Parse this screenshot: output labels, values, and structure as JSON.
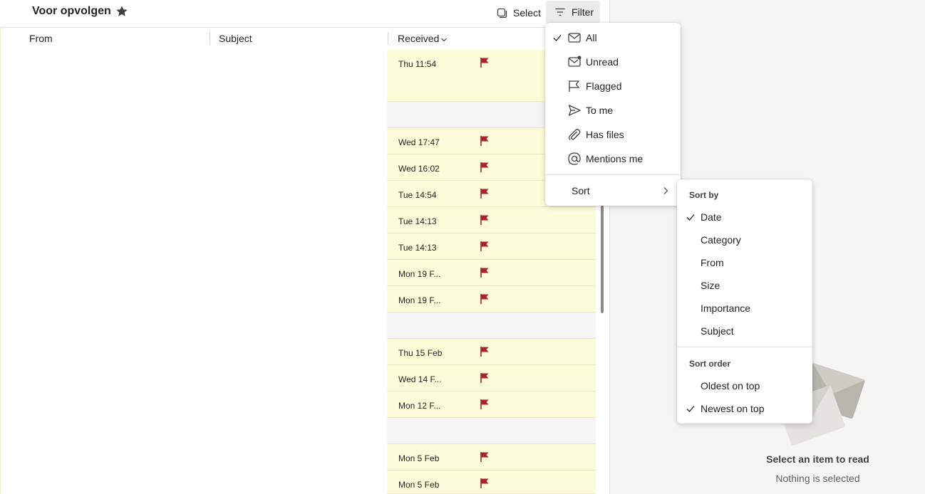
{
  "header": {
    "folder_title": "Voor opvolgen",
    "select_label": "Select",
    "filter_label": "Filter"
  },
  "columns": {
    "from": "From",
    "subject": "Subject",
    "received": "Received"
  },
  "rows": [
    {
      "date": "Thu 11:54",
      "flagged": true
    },
    {
      "date": "Wed 17:47",
      "flagged": true
    },
    {
      "date": "Wed 16:02",
      "flagged": true
    },
    {
      "date": "Tue 14:54",
      "flagged": true
    },
    {
      "date": "Tue 14:13",
      "flagged": true
    },
    {
      "date": "Tue 14:13",
      "flagged": true
    },
    {
      "date": "Mon 19 F...",
      "flagged": true
    },
    {
      "date": "Mon 19 F...",
      "flagged": true
    },
    {
      "date": "Thu 15 Feb",
      "flagged": true
    },
    {
      "date": "Wed 14 F...",
      "flagged": true
    },
    {
      "date": "Mon 12 F...",
      "flagged": true
    },
    {
      "date": "Mon 5 Feb",
      "flagged": true
    },
    {
      "date": "Mon 5 Feb",
      "flagged": true
    }
  ],
  "filter_menu": {
    "items": [
      {
        "label": "All",
        "icon": "mail-icon",
        "checked": true
      },
      {
        "label": "Unread",
        "icon": "mail-unread-icon",
        "checked": false
      },
      {
        "label": "Flagged",
        "icon": "flag-outline-icon",
        "checked": false
      },
      {
        "label": "To me",
        "icon": "send-icon",
        "checked": false
      },
      {
        "label": "Has files",
        "icon": "attach-icon",
        "checked": false
      },
      {
        "label": "Mentions me",
        "icon": "at-icon",
        "checked": false
      }
    ],
    "sort_label": "Sort"
  },
  "sort_menu": {
    "sort_by_heading": "Sort by",
    "sort_by": [
      {
        "label": "Date",
        "checked": true
      },
      {
        "label": "Category",
        "checked": false
      },
      {
        "label": "From",
        "checked": false
      },
      {
        "label": "Size",
        "checked": false
      },
      {
        "label": "Importance",
        "checked": false
      },
      {
        "label": "Subject",
        "checked": false
      }
    ],
    "sort_order_heading": "Sort order",
    "sort_order": [
      {
        "label": "Oldest on top",
        "checked": false
      },
      {
        "label": "Newest on top",
        "checked": true
      }
    ]
  },
  "reading_pane": {
    "title": "Select an item to read",
    "subtitle": "Nothing is selected"
  },
  "colors": {
    "flag": "#a4262c",
    "row_bg": "#fdfcda",
    "accent": "#242424"
  }
}
